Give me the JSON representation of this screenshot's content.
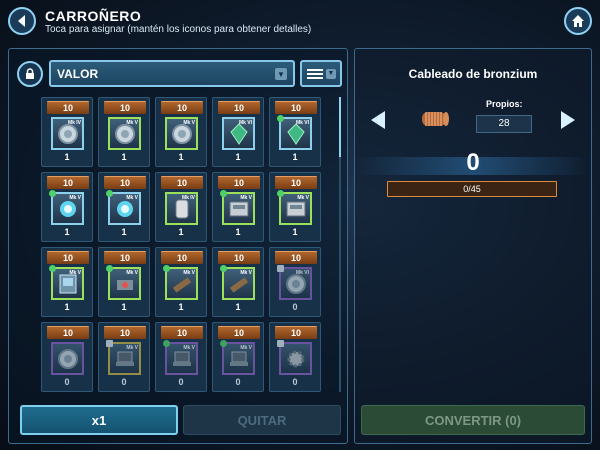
{
  "header": {
    "title": "CARROÑERO",
    "subtitle": "Toca para asignar (mantén los iconos para obtener detalles)",
    "back_icon": "back-arrow-icon",
    "home_icon": "home-icon"
  },
  "filters": {
    "sort_value": "VALOR",
    "lock_icon": "lock-icon",
    "filter_icon": "filter-list-icon"
  },
  "grid": {
    "rows": [
      [
        {
          "badge": "10",
          "mk": "Mk IV",
          "count": "1",
          "tier": "blue",
          "icon": "circular-device-icon",
          "mark": "none"
        },
        {
          "badge": "10",
          "mk": "Mk V",
          "count": "1",
          "tier": "green",
          "icon": "circular-device-icon",
          "mark": "none"
        },
        {
          "badge": "10",
          "mk": "Mk V",
          "count": "1",
          "tier": "green",
          "icon": "circular-device-icon",
          "mark": "none"
        },
        {
          "badge": "10",
          "mk": "Mk VI",
          "count": "1",
          "tier": "blue",
          "icon": "green-crystal-icon",
          "mark": "none"
        },
        {
          "badge": "10",
          "mk": "Mk VI",
          "count": "1",
          "tier": "blue",
          "icon": "green-crystal-icon",
          "mark": "dot"
        }
      ],
      [
        {
          "badge": "10",
          "mk": "Mk V",
          "count": "1",
          "tier": "blue",
          "icon": "energy-orb-icon",
          "mark": "dot"
        },
        {
          "badge": "10",
          "mk": "Mk V",
          "count": "1",
          "tier": "blue",
          "icon": "energy-orb-icon",
          "mark": "dot"
        },
        {
          "badge": "10",
          "mk": "Mk IV",
          "count": "1",
          "tier": "green",
          "icon": "capsule-device-icon",
          "mark": "none"
        },
        {
          "badge": "10",
          "mk": "Mk V",
          "count": "1",
          "tier": "green",
          "icon": "machine-unit-icon",
          "mark": "dot"
        },
        {
          "badge": "10",
          "mk": "Mk V",
          "count": "1",
          "tier": "green",
          "icon": "machine-unit-icon",
          "mark": "dot"
        }
      ],
      [
        {
          "badge": "10",
          "mk": "Mk V",
          "count": "1",
          "tier": "green",
          "icon": "datapad-icon",
          "mark": "dot"
        },
        {
          "badge": "10",
          "mk": "Mk V",
          "count": "1",
          "tier": "green",
          "icon": "sensor-device-icon",
          "mark": "dot"
        },
        {
          "badge": "10",
          "mk": "Mk V",
          "count": "1",
          "tier": "green",
          "icon": "blaster-part-icon",
          "mark": "dot"
        },
        {
          "badge": "10",
          "mk": "Mk V",
          "count": "1",
          "tier": "green",
          "icon": "blaster-part-icon",
          "mark": "dot"
        },
        {
          "badge": "10",
          "mk": "Mk VI",
          "count": "0",
          "tier": "purple",
          "icon": "circular-device-icon",
          "mark": "lock"
        }
      ],
      [
        {
          "badge": "10",
          "mk": "",
          "count": "0",
          "tier": "purple",
          "icon": "circular-device-icon",
          "mark": "none"
        },
        {
          "badge": "10",
          "mk": "Mk V",
          "count": "0",
          "tier": "yellow",
          "icon": "laptop-device-icon",
          "mark": "lock"
        },
        {
          "badge": "10",
          "mk": "Mk V",
          "count": "0",
          "tier": "purple",
          "icon": "laptop-device-icon",
          "mark": "dot"
        },
        {
          "badge": "10",
          "mk": "Mk V",
          "count": "0",
          "tier": "purple",
          "icon": "laptop-device-icon",
          "mark": "dot"
        },
        {
          "badge": "10",
          "mk": "",
          "count": "0",
          "tier": "purple",
          "icon": "gear-part-icon",
          "mark": "lock"
        }
      ]
    ]
  },
  "bottom_left": {
    "multiplier_label": "x1",
    "remove_label": "QUITAR"
  },
  "detail": {
    "item_name": "Cableado de bronzium",
    "item_icon": "bronzium-wire-coil-icon",
    "owned_label": "Propios:",
    "owned_value": "28",
    "selected_count": "0",
    "progress_text": "0/45",
    "progress_fraction": 0,
    "convert_label": "CONVERTIR (0)"
  },
  "colors": {
    "accent": "#8fd2f4",
    "badge_orange": "#b0662c",
    "tier_green": "#9ae05a",
    "tier_purple": "#8c62c4",
    "convert_disabled": "#2b4b37"
  }
}
